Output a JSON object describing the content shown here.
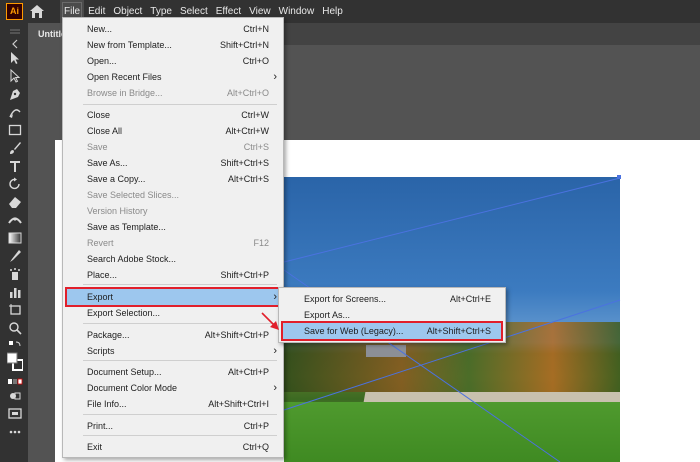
{
  "app": {
    "logo_text": "Ai",
    "accent": "#ff9a00"
  },
  "menubar": {
    "items": [
      "File",
      "Edit",
      "Object",
      "Type",
      "Select",
      "Effect",
      "View",
      "Window",
      "Help"
    ],
    "active": "File"
  },
  "document_tab": {
    "title": "Untitled"
  },
  "file_menu": [
    {
      "label": "New...",
      "shortcut": "Ctrl+N"
    },
    {
      "label": "New from Template...",
      "shortcut": "Shift+Ctrl+N"
    },
    {
      "label": "Open...",
      "shortcut": "Ctrl+O"
    },
    {
      "label": "Open Recent Files",
      "shortcut": "",
      "submenu": true
    },
    {
      "label": "Browse in Bridge...",
      "shortcut": "Alt+Ctrl+O",
      "disabled": true
    },
    {
      "label": "Close",
      "shortcut": "Ctrl+W"
    },
    {
      "label": "Close All",
      "shortcut": "Alt+Ctrl+W"
    },
    {
      "label": "Save",
      "shortcut": "Ctrl+S",
      "disabled": true
    },
    {
      "label": "Save As...",
      "shortcut": "Shift+Ctrl+S"
    },
    {
      "label": "Save a Copy...",
      "shortcut": "Alt+Ctrl+S"
    },
    {
      "label": "Save Selected Slices...",
      "shortcut": "",
      "disabled": true
    },
    {
      "label": "Version History",
      "shortcut": "",
      "disabled": true
    },
    {
      "label": "Save as Template...",
      "shortcut": ""
    },
    {
      "label": "Revert",
      "shortcut": "F12",
      "disabled": true
    },
    {
      "label": "Search Adobe Stock...",
      "shortcut": ""
    },
    {
      "label": "Place...",
      "shortcut": "Shift+Ctrl+P"
    },
    {
      "label": "Export",
      "shortcut": "",
      "submenu": true,
      "highlighted": true
    },
    {
      "label": "Export Selection...",
      "shortcut": ""
    },
    {
      "label": "Package...",
      "shortcut": "Alt+Shift+Ctrl+P"
    },
    {
      "label": "Scripts",
      "shortcut": "",
      "submenu": true
    },
    {
      "label": "Document Setup...",
      "shortcut": "Alt+Ctrl+P"
    },
    {
      "label": "Document Color Mode",
      "shortcut": "",
      "submenu": true
    },
    {
      "label": "File Info...",
      "shortcut": "Alt+Shift+Ctrl+I"
    },
    {
      "label": "Print...",
      "shortcut": "Ctrl+P"
    },
    {
      "label": "Exit",
      "shortcut": "Ctrl+Q"
    }
  ],
  "export_submenu": [
    {
      "label": "Export for Screens...",
      "shortcut": "Alt+Ctrl+E"
    },
    {
      "label": "Export As...",
      "shortcut": ""
    },
    {
      "label": "Save for Web (Legacy)...",
      "shortcut": "Alt+Shift+Ctrl+S",
      "highlighted": true
    }
  ],
  "colors": {
    "highlight_fill": "#9dc7ee",
    "callout_red": "#e11f2b",
    "menu_bg": "#f0f0f0",
    "chrome_dark": "#323232"
  },
  "tools": [
    "selection-tool-icon",
    "direct-selection-tool-icon",
    "pen-tool-icon",
    "curvature-tool-icon",
    "rectangle-tool-icon",
    "paintbrush-tool-icon",
    "pencil-tool-icon",
    "type-tool-icon",
    "rotate-tool-icon",
    "eraser-tool-icon",
    "scale-tool-icon",
    "width-tool-icon",
    "gradient-tool-icon",
    "eyedropper-tool-icon",
    "symbol-sprayer-tool-icon",
    "graph-tool-icon",
    "artboard-tool-icon",
    "hand-tool-icon",
    "zoom-tool-icon",
    "swap-colors-icon",
    "fill-color-swatch",
    "stroke-color-swatch",
    "color-mode-icon",
    "draw-mode-icon",
    "screen-mode-icon",
    "more-tools-icon"
  ]
}
